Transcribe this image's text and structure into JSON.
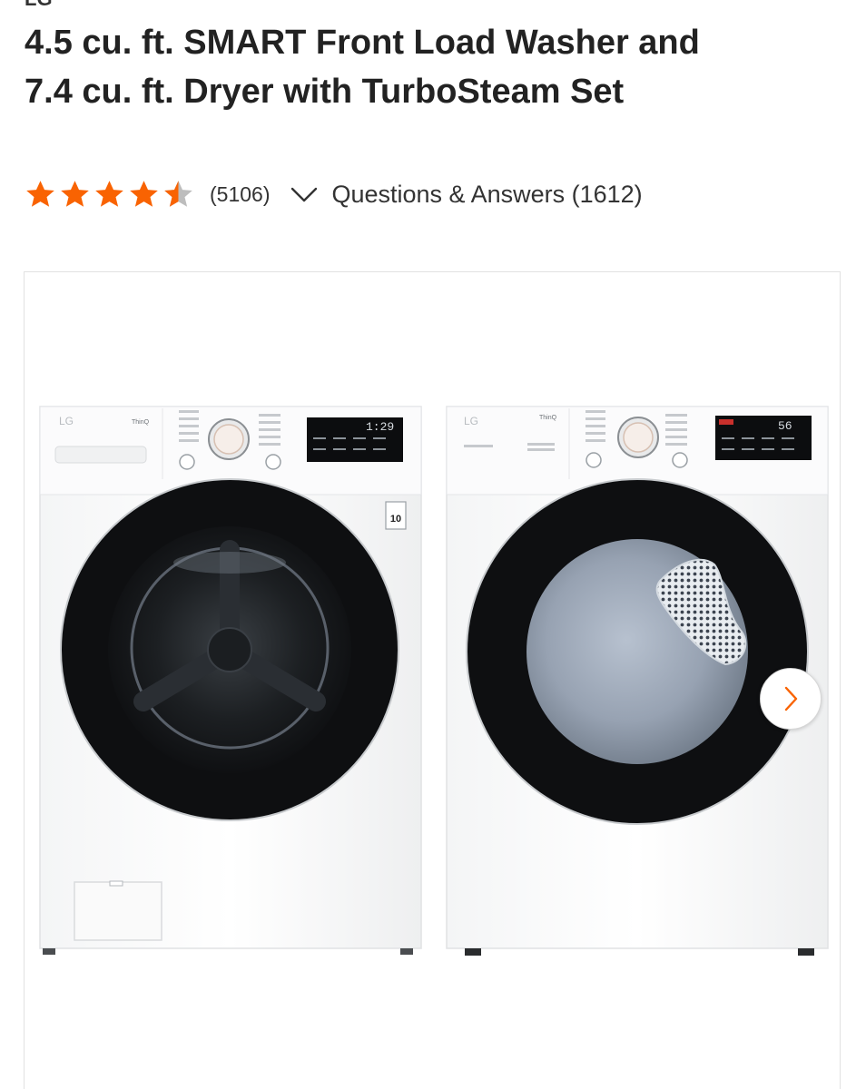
{
  "product": {
    "brand": "LG",
    "title": "4.5 cu. ft. SMART Front Load Washer and 7.4 cu. ft. Dryer with TurboSteam Set",
    "rating": 4.5,
    "review_count": "(5106)",
    "qa_link": "Questions & Answers (1612)"
  },
  "gallery": {
    "washer": {
      "logo": "LG",
      "thinq_label": "ThinQ",
      "display_readout": "1:29",
      "badge": "10"
    },
    "dryer": {
      "logo": "LG",
      "thinq_label": "ThinQ",
      "display_readout": "56"
    },
    "next_icon": "chevron-right-icon"
  },
  "colors": {
    "star": "#f96302",
    "text": "#222222",
    "accent": "#f96302",
    "border": "#e2e2e2"
  }
}
